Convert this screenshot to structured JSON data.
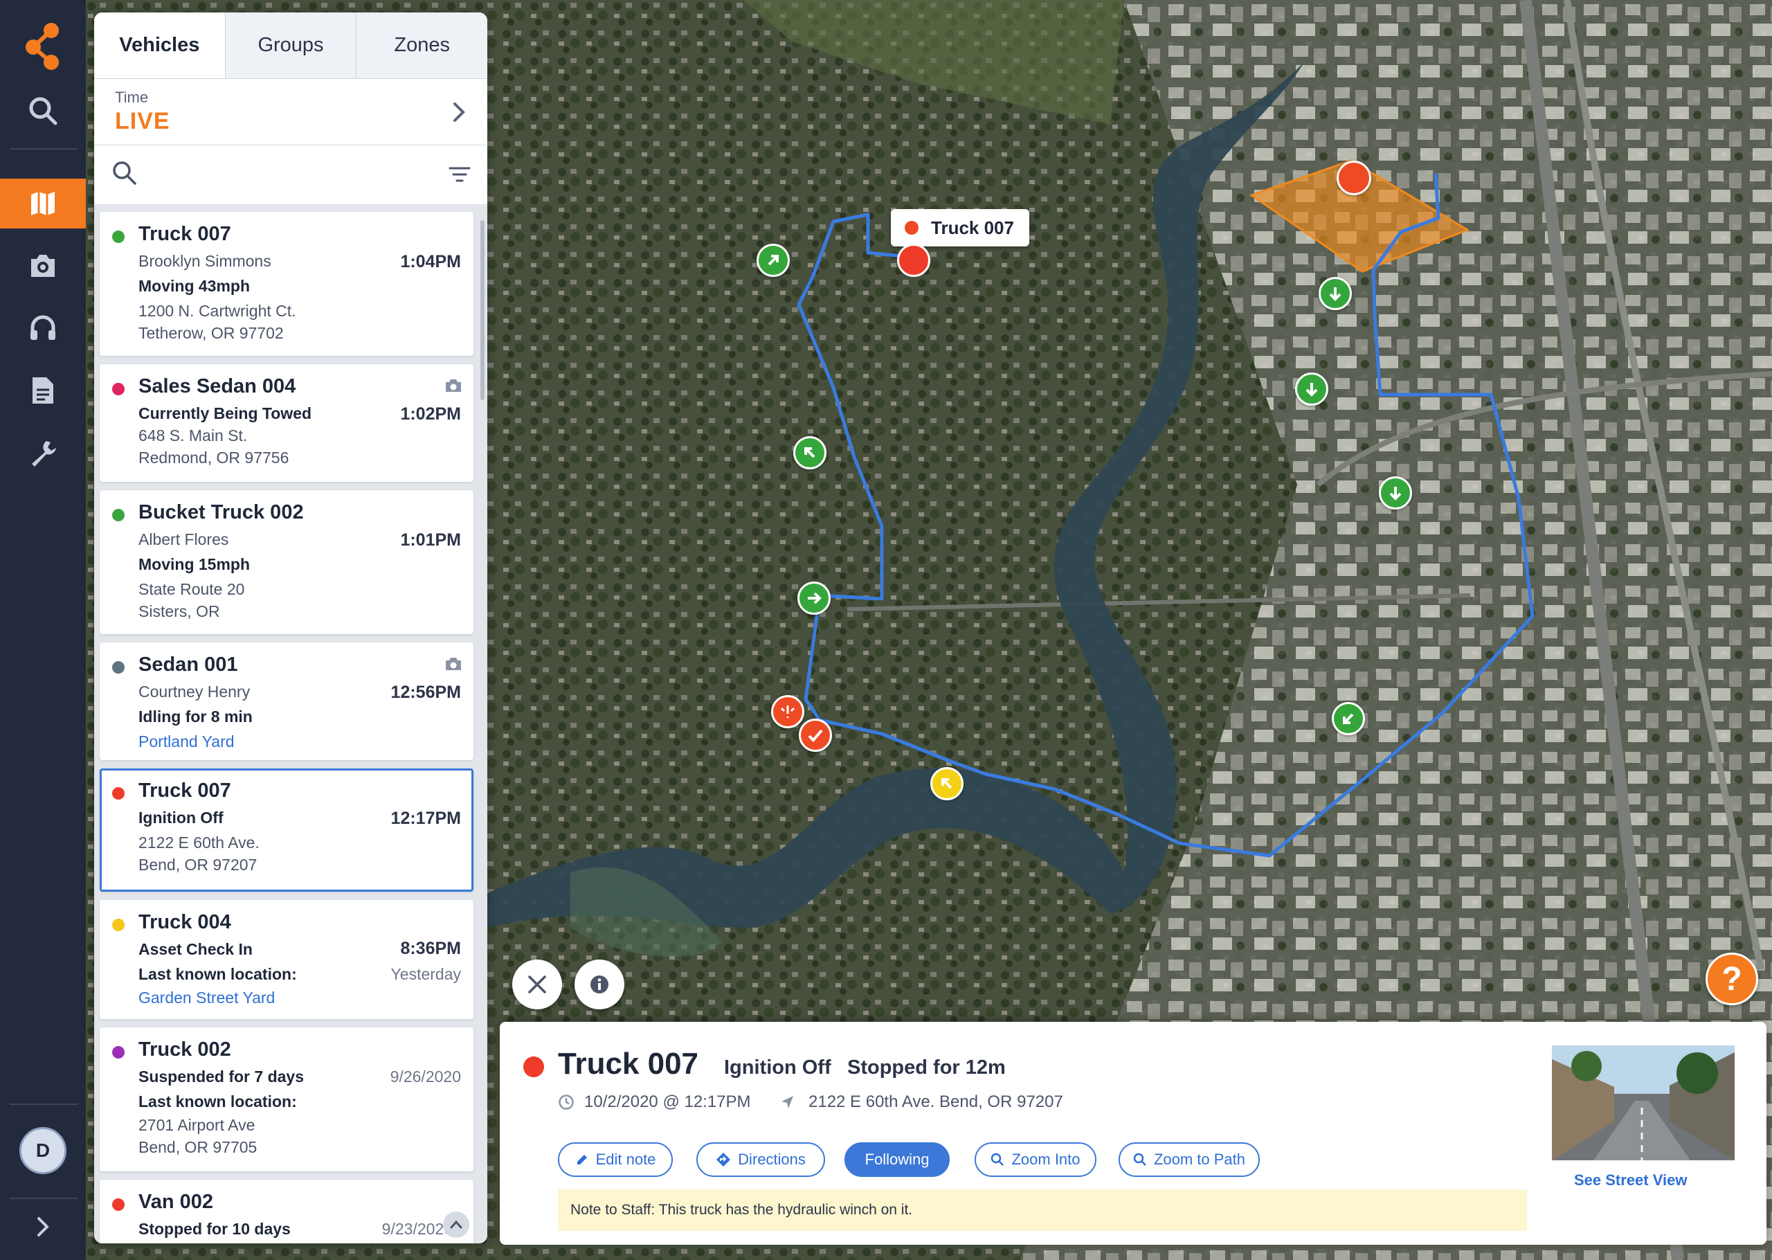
{
  "nav": {
    "items": [
      "logo-icon",
      "search-icon",
      "map-icon",
      "camera-icon",
      "headset-icon",
      "document-icon",
      "wrench-icon"
    ],
    "active": "map-icon",
    "avatar_initial": "D",
    "accent": "#f47b20"
  },
  "panel": {
    "tabs": [
      {
        "label": "Vehicles",
        "active": true
      },
      {
        "label": "Groups",
        "active": false
      },
      {
        "label": "Zones",
        "active": false
      }
    ],
    "time": {
      "label": "Time",
      "value": "LIVE"
    },
    "search": {
      "placeholder": ""
    }
  },
  "vehicles": [
    {
      "name": "Truck 007",
      "status_color": "#3aa53f",
      "lines": [
        "Brooklyn Simmons",
        "Moving 43mph",
        "1200 N. Cartwright Ct.",
        "Tetherow, OR 97702"
      ],
      "time": "1:04PM"
    },
    {
      "name": "Sales Sedan 004",
      "status_color": "#e0245e",
      "lines": [
        "Currently Being Towed",
        "648 S. Main St.",
        "Redmond, OR 97756"
      ],
      "time": "1:02PM",
      "camera": true
    },
    {
      "name": "Bucket Truck 002",
      "status_color": "#3aa53f",
      "lines": [
        "Albert Flores",
        "Moving 15mph",
        "State Route 20",
        "Sisters, OR"
      ],
      "time": "1:01PM"
    },
    {
      "name": "Sedan 001",
      "status_color": "#5f7480",
      "lines": [
        "Courtney Henry",
        "Idling for 8 min",
        "Portland Yard"
      ],
      "time": "12:56PM",
      "camera": true
    },
    {
      "name": "Truck 007",
      "status_color": "#ee3b2a",
      "lines": [
        "Ignition Off",
        "2122 E 60th Ave.",
        "Bend, OR 97207"
      ],
      "time": "12:17PM",
      "selected": true
    },
    {
      "name": "Truck 004",
      "status_color": "#f5c518",
      "lines": [
        "Asset Check In",
        "Last known location:",
        "Garden Street Yard"
      ],
      "time": "8:36PM",
      "sub_time": "Yesterday"
    },
    {
      "name": "Truck 002",
      "status_color": "#9c2fb8",
      "lines": [
        "Suspended for 7 days",
        "Last known location:",
        "2701 Airport Ave",
        "Bend, OR 97705"
      ],
      "time": "9/26/2020"
    },
    {
      "name": "Van 002",
      "status_color": "#ee3b2a",
      "lines": [
        "Stopped for 10 days"
      ],
      "time": "9/23/2020"
    }
  ],
  "map": {
    "callout": "Truck 007",
    "help_label": "?"
  },
  "detail": {
    "title": "Truck 007",
    "status": "Ignition Off",
    "duration": "Stopped for 12m",
    "datetime": "10/2/2020 @ 12:17PM",
    "address": "2122 E 60th Ave. Bend, OR 97207",
    "actions": [
      {
        "label": "Edit note",
        "icon": "pencil-icon"
      },
      {
        "label": "Directions",
        "icon": "directions-icon"
      },
      {
        "label": "Following",
        "icon": "",
        "primary": true
      },
      {
        "label": "Zoom Into",
        "icon": "magnifier-icon"
      },
      {
        "label": "Zoom to Path",
        "icon": "magnifier-icon"
      }
    ],
    "note": "Note to Staff: This truck has the hydraulic winch on it.",
    "street_view_link": "See Street View"
  }
}
